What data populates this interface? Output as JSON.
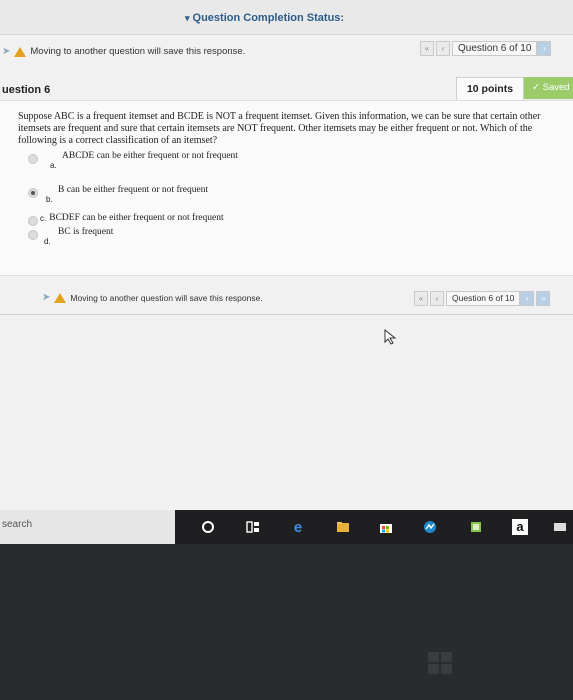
{
  "header": {
    "completion_status": "Question Completion Status:"
  },
  "top_nav": {
    "warning": "Moving to another question will save this response.",
    "question_position": "Question 6 of 10"
  },
  "question": {
    "title": "uestion 6",
    "points": "10 points",
    "saved": "Saved",
    "text": "Suppose ABC is a frequent itemset and BCDE is NOT a frequent itemset. Given this information, we can be sure that certain other itemsets are frequent and sure that certain itemsets are NOT frequent. Other itemsets may be either frequent or not. Which of the following is a correct classification of an itemset?",
    "options": [
      {
        "letter": "a.",
        "text": "ABCDE can be either frequent or not frequent"
      },
      {
        "letter": "b.",
        "text": "B can be either frequent or not frequent"
      },
      {
        "letter": "c.",
        "text": "BCDEF can be either frequent or not frequent"
      },
      {
        "letter": "d.",
        "text": "BC is frequent"
      }
    ],
    "selected_option": "b."
  },
  "bottom_nav": {
    "warning": "Moving to another question will save this response.",
    "question_position": "Question 6 of 10"
  },
  "taskbar": {
    "search_label": "search",
    "icons": [
      "cortana-icon",
      "task-view-icon",
      "edge-icon",
      "file-explorer-icon",
      "store-icon",
      "photos-icon",
      "app-icon",
      "amazon-icon",
      "app2-icon"
    ]
  },
  "colors": {
    "accent": "#2b5c8a",
    "saved_green": "#9ccc6a",
    "warning_amber": "#e2a21d"
  }
}
